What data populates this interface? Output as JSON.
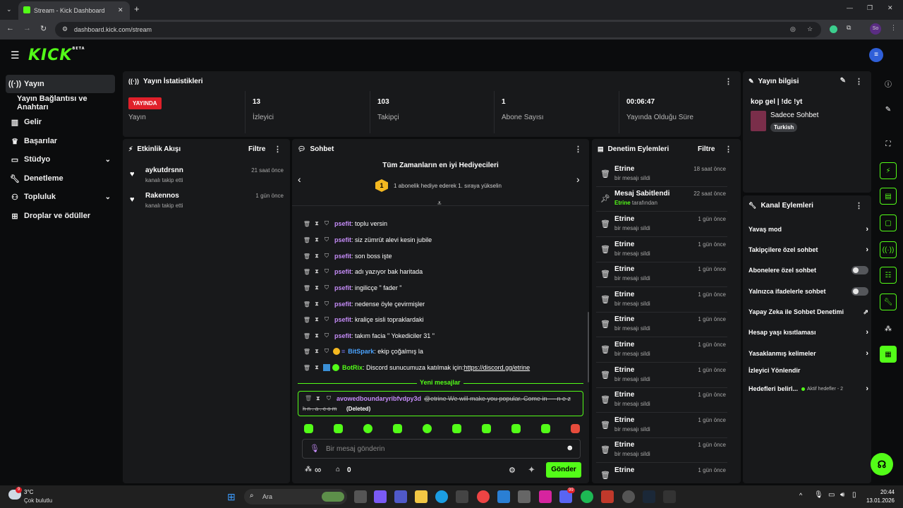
{
  "browser": {
    "tab_title": "Stream - Kick Dashboard",
    "url": "dashboard.kick.com/stream",
    "profile": "So"
  },
  "app": {
    "logo": "KICK",
    "logo_tag": "BETA"
  },
  "sidebar": {
    "items": [
      {
        "label": "Yayın",
        "icon": "broadcast-icon"
      },
      {
        "label": "Yayın Bağlantısı ve Anahtarı",
        "icon": ""
      },
      {
        "label": "Gelir",
        "icon": "chart-icon"
      },
      {
        "label": "Başarılar",
        "icon": "trophy-icon"
      },
      {
        "label": "Stüdyo",
        "icon": "studio-icon"
      },
      {
        "label": "Denetleme",
        "icon": "wrench-icon"
      },
      {
        "label": "Topluluk",
        "icon": "people-icon"
      },
      {
        "label": "Droplar ve ödüller",
        "icon": "gift-icon"
      }
    ]
  },
  "stats": {
    "title": "Yayın İstatistikleri",
    "live_badge": "YAYINDA",
    "status_label": "Yayın",
    "viewers_value": "13",
    "viewers_label": "İzleyici",
    "followers_value": "103",
    "followers_label": "Takipçi",
    "subs_value": "1",
    "subs_label": "Abone Sayısı",
    "duration_value": "00:06:47",
    "duration_label": "Yayında Olduğu Süre"
  },
  "stream_info": {
    "title": "Yayın bilgisi",
    "stream_title": "kop gel | !dc !yt",
    "category": "Sadece Sohbet",
    "tag": "Turkish"
  },
  "activity": {
    "title": "Etkinlik Akışı",
    "filter": "Filtre",
    "items": [
      {
        "name": "aykutdrsnn",
        "sub": "kanalı takip etti",
        "time": "21 saat önce"
      },
      {
        "name": "Rakennos",
        "sub": "kanalı takip etti",
        "time": "1 gün önce"
      }
    ]
  },
  "chat": {
    "title": "Sohbet",
    "gifters_title": "Tüm Zamanların en iyi Hediyecileri",
    "gifters_rank": "1",
    "gifters_sub": "1 abonelik hediye ederek 1. sıraya yükselin",
    "messages": [
      {
        "user": "psefit",
        "text": "toplu versin"
      },
      {
        "user": "psefit",
        "text": "siz zümrüt alevi kesin jubile"
      },
      {
        "user": "psefit",
        "text": "son boss işte"
      },
      {
        "user": "psefit",
        "text": "adı yazıyor bak haritada"
      },
      {
        "user": "psefit",
        "text": "ingilicçe \" fader \""
      },
      {
        "user": "psefit",
        "text": "nedense öyle çevirmişler"
      },
      {
        "user": "psefit",
        "text": "kraliçe sisli topraklardaki"
      },
      {
        "user": "psefit",
        "text": "takım facia \" Yokediciler 31 \""
      },
      {
        "user": "BitSpark",
        "text": "ekip çoğalmış la"
      },
      {
        "user": "BotRix",
        "text": "Discord sunucumuza katılmak için: ",
        "link": "https://discord.gg/etrine"
      }
    ],
    "new_messages": "Yeni mesajlar",
    "deleted_user": "avowedboundaryribfvdpy3d",
    "deleted_text_1": "@etrine We will make you popular. Come in --- n e z",
    "deleted_text_2": "h n . a . c o m",
    "deleted_tag": "(Deleted)",
    "input_placeholder": "Bir mesaj gönderin",
    "infinity": "∞",
    "points": "0",
    "send": "Gönder"
  },
  "moderation": {
    "title": "Denetim Eylemleri",
    "filter": "Filtre",
    "items": [
      {
        "name": "Etrine",
        "sub": "bir mesajı sildi",
        "time": "18 saat önce"
      },
      {
        "name": "Mesaj Sabitlendi",
        "sub_user": "Etrine",
        "sub": "tarafından",
        "time": "22 saat önce"
      },
      {
        "name": "Etrine",
        "sub": "bir mesajı sildi",
        "time": "1 gün önce"
      },
      {
        "name": "Etrine",
        "sub": "bir mesajı sildi",
        "time": "1 gün önce"
      },
      {
        "name": "Etrine",
        "sub": "bir mesajı sildi",
        "time": "1 gün önce"
      },
      {
        "name": "Etrine",
        "sub": "bir mesajı sildi",
        "time": "1 gün önce"
      },
      {
        "name": "Etrine",
        "sub": "bir mesajı sildi",
        "time": "1 gün önce"
      },
      {
        "name": "Etrine",
        "sub": "bir mesajı sildi",
        "time": "1 gün önce"
      },
      {
        "name": "Etrine",
        "sub": "bir mesajı sildi",
        "time": "1 gün önce"
      },
      {
        "name": "Etrine",
        "sub": "bir mesajı sildi",
        "time": "1 gün önce"
      },
      {
        "name": "Etrine",
        "sub": "bir mesajı sildi",
        "time": "1 gün önce"
      },
      {
        "name": "Etrine",
        "sub": "bir mesajı sildi",
        "time": "1 gün önce"
      },
      {
        "name": "Etrine",
        "sub": "",
        "time": "1 gün önce"
      }
    ]
  },
  "channel": {
    "title": "Kanal Eylemleri",
    "slow_mode": "Yavaş mod",
    "followers_only": "Takipçilere özel sohbet",
    "subs_only": "Abonelere özel sohbet",
    "emotes_only": "Yalnızca ifadelerle sohbet",
    "ai_moderation": "Yapay Zeka ile Sohbet Denetimi",
    "account_age": "Hesap yaşı kısıtlaması",
    "banned_words": "Yasaklanmış kelimeler",
    "redirect": "İzleyici Yönlendir",
    "goals": "Hedefleri belirl...",
    "goals_status": "Aktif hedefler - 2"
  },
  "taskbar": {
    "temp": "3°C",
    "weather": "Çok bulutlu",
    "search": "Ara",
    "time": "20:44",
    "date": "13.01.2026",
    "notif_badge": "99"
  },
  "colors": {
    "accent": "#53fc18",
    "live": "#e0202a",
    "user": "#c58cf8",
    "panel": "#18191b"
  }
}
